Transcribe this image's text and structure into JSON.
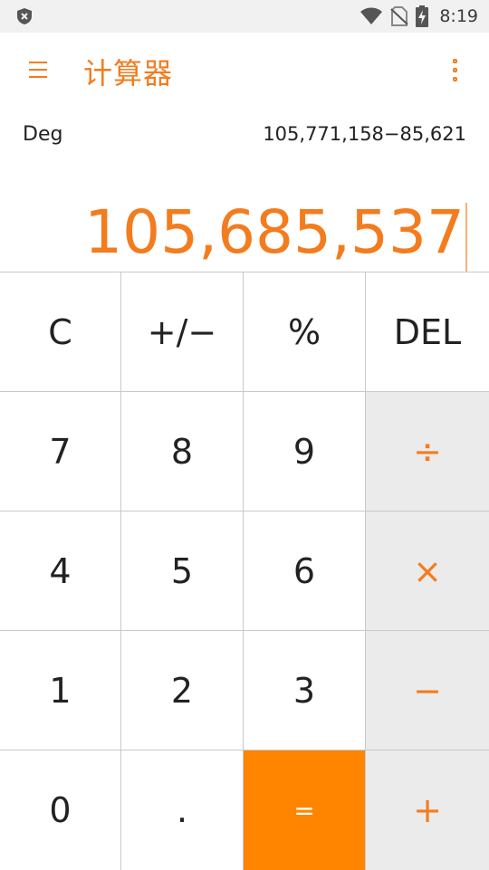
{
  "status_bar": {
    "time": "8:19",
    "icons": [
      "shield-icon",
      "wifi-icon",
      "no-sim-icon",
      "battery-charging-icon"
    ]
  },
  "app_bar": {
    "title": "计算器",
    "menu_icon": "hamburger-menu-icon",
    "more_icon": "more-vert-icon"
  },
  "display": {
    "mode": "Deg",
    "expression": "105,771,158−85,621",
    "result": "105,685,537"
  },
  "keypad": {
    "clear": "C",
    "negate": "+/−",
    "percent": "%",
    "delete": "DEL",
    "seven": "7",
    "eight": "8",
    "nine": "9",
    "divide": "÷",
    "four": "4",
    "five": "5",
    "six": "6",
    "multiply": "×",
    "one": "1",
    "two": "2",
    "three": "3",
    "subtract": "−",
    "zero": "0",
    "decimal": ".",
    "equals": "=",
    "add": "+"
  },
  "colors": {
    "accent": "#f37c1e",
    "equals_bg": "#ff8400",
    "operator_bg": "#ebebeb",
    "status_bar_bg": "#f1f1f1"
  }
}
